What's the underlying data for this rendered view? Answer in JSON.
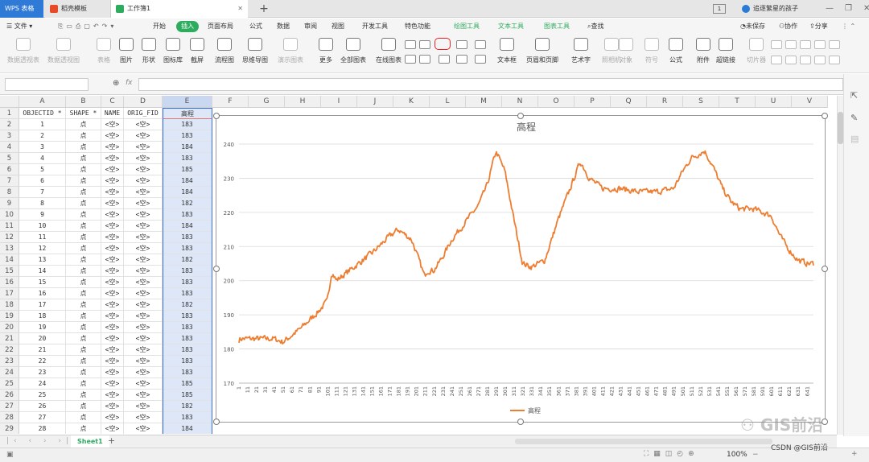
{
  "app": {
    "tabs": [
      {
        "label": "WPS 表格"
      },
      {
        "label": "稻壳模板"
      },
      {
        "label": "工作簿1"
      }
    ],
    "user": "追逐繁星的孩子",
    "window_badge": "1"
  },
  "menu": {
    "file": "文件",
    "items": [
      "开始",
      "插入",
      "页面布局",
      "公式",
      "数据",
      "审阅",
      "视图",
      "开发工具",
      "特色功能"
    ],
    "active": "插入",
    "contextual": [
      "绘图工具",
      "文本工具",
      "图表工具"
    ],
    "search": "查找",
    "right": [
      "未保存",
      "协作",
      "分享"
    ]
  },
  "ribbon": {
    "buttons": [
      {
        "label": "数据透视表",
        "disabled": true
      },
      {
        "label": "数据透视图",
        "disabled": true
      },
      {
        "label": "表格",
        "disabled": true
      },
      {
        "label": "图片",
        "disabled": false
      },
      {
        "label": "形状",
        "disabled": false
      },
      {
        "label": "图标库",
        "disabled": false
      },
      {
        "label": "截屏",
        "disabled": false
      },
      {
        "label": "流程图",
        "disabled": false
      },
      {
        "label": "思维导图",
        "disabled": false
      },
      {
        "label": "演示图表",
        "disabled": true
      },
      {
        "label": "更多",
        "disabled": false
      },
      {
        "label": "全部图表",
        "disabled": false
      },
      {
        "label": "在线图表",
        "disabled": false
      }
    ],
    "right_buttons": [
      {
        "label": "文本框"
      },
      {
        "label": "页眉和页脚"
      },
      {
        "label": "艺术字"
      },
      {
        "label": "照相机",
        "disabled": true
      },
      {
        "label": "对象",
        "disabled": true
      },
      {
        "label": "符号",
        "disabled": true
      },
      {
        "label": "公式"
      },
      {
        "label": "附件"
      },
      {
        "label": "超链接"
      },
      {
        "label": "切片器",
        "disabled": true
      }
    ]
  },
  "formula_bar": {
    "fx": "fx",
    "name_box": "",
    "value": ""
  },
  "sheet": {
    "columns": [
      "A",
      "B",
      "C",
      "D",
      "E",
      "F",
      "G",
      "H",
      "I",
      "J",
      "K",
      "L",
      "M",
      "N",
      "O",
      "P",
      "Q",
      "R",
      "S",
      "T",
      "U",
      "V"
    ],
    "headers": [
      "OBJECTID *",
      "SHAPE *",
      "NAME",
      "ORIG_FID",
      "高程"
    ],
    "rows": [
      [
        "1",
        "点",
        "<空>",
        "<空>",
        "183"
      ],
      [
        "2",
        "点",
        "<空>",
        "<空>",
        "183"
      ],
      [
        "3",
        "点",
        "<空>",
        "<空>",
        "184"
      ],
      [
        "4",
        "点",
        "<空>",
        "<空>",
        "183"
      ],
      [
        "5",
        "点",
        "<空>",
        "<空>",
        "185"
      ],
      [
        "6",
        "点",
        "<空>",
        "<空>",
        "184"
      ],
      [
        "7",
        "点",
        "<空>",
        "<空>",
        "184"
      ],
      [
        "8",
        "点",
        "<空>",
        "<空>",
        "182"
      ],
      [
        "9",
        "点",
        "<空>",
        "<空>",
        "183"
      ],
      [
        "10",
        "点",
        "<空>",
        "<空>",
        "184"
      ],
      [
        "11",
        "点",
        "<空>",
        "<空>",
        "183"
      ],
      [
        "12",
        "点",
        "<空>",
        "<空>",
        "183"
      ],
      [
        "13",
        "点",
        "<空>",
        "<空>",
        "182"
      ],
      [
        "14",
        "点",
        "<空>",
        "<空>",
        "183"
      ],
      [
        "15",
        "点",
        "<空>",
        "<空>",
        "183"
      ],
      [
        "16",
        "点",
        "<空>",
        "<空>",
        "183"
      ],
      [
        "17",
        "点",
        "<空>",
        "<空>",
        "182"
      ],
      [
        "18",
        "点",
        "<空>",
        "<空>",
        "183"
      ],
      [
        "19",
        "点",
        "<空>",
        "<空>",
        "183"
      ],
      [
        "20",
        "点",
        "<空>",
        "<空>",
        "183"
      ],
      [
        "21",
        "点",
        "<空>",
        "<空>",
        "183"
      ],
      [
        "22",
        "点",
        "<空>",
        "<空>",
        "183"
      ],
      [
        "23",
        "点",
        "<空>",
        "<空>",
        "183"
      ],
      [
        "24",
        "点",
        "<空>",
        "<空>",
        "185"
      ],
      [
        "25",
        "点",
        "<空>",
        "<空>",
        "185"
      ],
      [
        "26",
        "点",
        "<空>",
        "<空>",
        "182"
      ],
      [
        "27",
        "点",
        "<空>",
        "<空>",
        "183"
      ],
      [
        "28",
        "点",
        "<空>",
        "<空>",
        "184"
      ],
      [
        "29",
        "点",
        "<空>",
        "<空>",
        "182"
      ]
    ],
    "tab": "Sheet1"
  },
  "chart_data": {
    "type": "line",
    "title": "高程",
    "ylim": [
      170,
      240
    ],
    "yticks": [
      170,
      180,
      190,
      200,
      210,
      220,
      230,
      240
    ],
    "x_tick_start": 1,
    "x_tick_step": 10,
    "x_tick_end": 641,
    "n_points": 648,
    "legend_position": "bottom",
    "series": [
      {
        "name": "高程",
        "color": "#ED7D31",
        "profile_x": [
          1,
          20,
          40,
          50,
          55,
          70,
          90,
          100,
          105,
          110,
          130,
          150,
          170,
          180,
          195,
          210,
          212,
          220,
          230,
          240,
          255,
          270,
          280,
          290,
          300,
          310,
          320,
          330,
          345,
          360,
          375,
          385,
          395,
          410,
          430,
          450,
          470,
          490,
          500,
          510,
          525,
          535,
          545,
          555,
          565,
          580,
          600,
          610,
          620,
          630,
          641,
          648
        ],
        "profile_y": [
          183,
          183,
          183,
          182,
          183,
          186,
          191,
          194,
          203,
          200,
          204,
          208,
          213,
          215,
          212,
          201,
          203,
          203,
          207,
          212,
          217,
          222,
          228,
          238,
          232,
          218,
          205,
          204,
          206,
          218,
          228,
          235,
          230,
          227,
          227,
          226,
          226,
          227,
          232,
          236,
          238,
          233,
          227,
          223,
          221,
          221,
          219,
          213,
          209,
          206,
          205,
          205
        ]
      }
    ]
  },
  "status": {
    "zoom": "100%",
    "watermark": "GIS前沿",
    "credit": "CSDN @GIS前沿"
  }
}
